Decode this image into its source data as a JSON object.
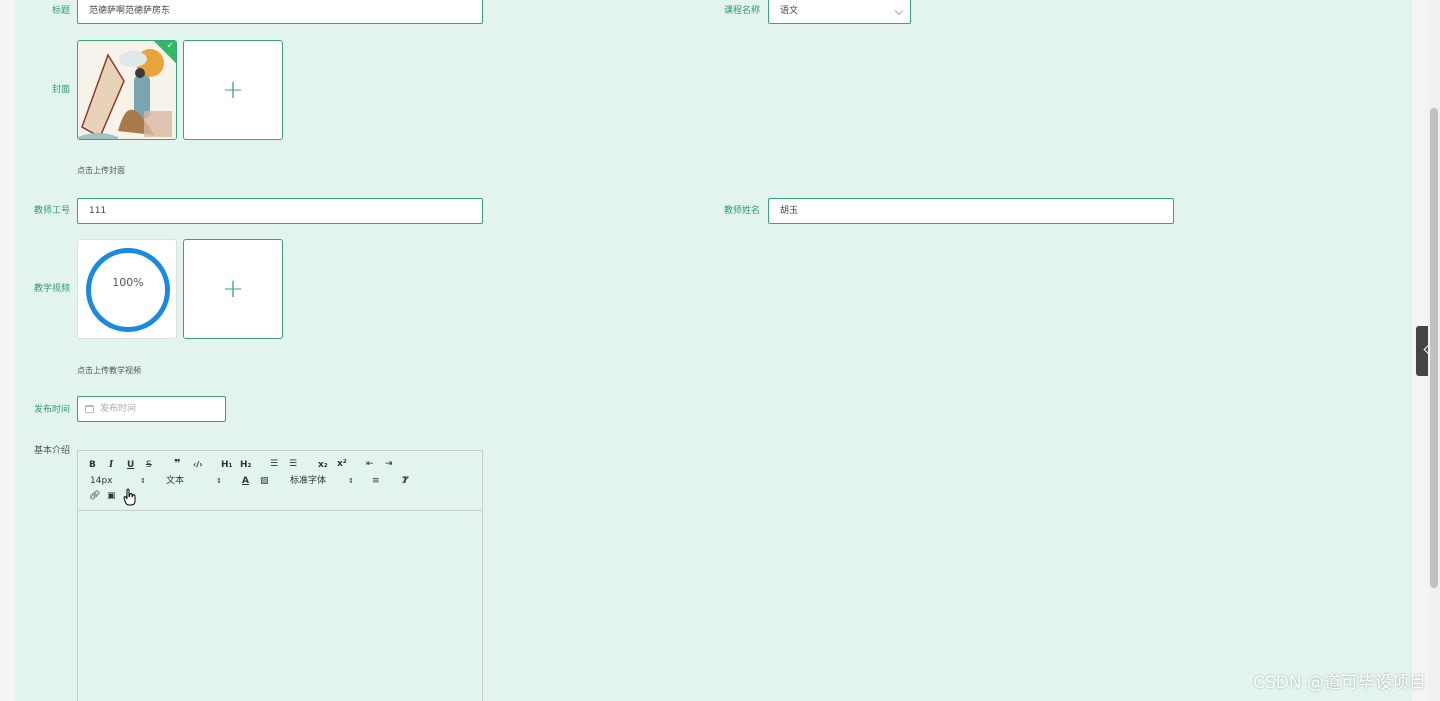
{
  "form": {
    "title": {
      "label": "标题",
      "value": "范德萨啊范德萨房东"
    },
    "course": {
      "label": "课程名称",
      "value": "语文"
    },
    "cover": {
      "label": "封面",
      "hint": "点击上传封面"
    },
    "teacher_id": {
      "label": "教师工号",
      "value": "111"
    },
    "teacher_name": {
      "label": "教师姓名",
      "value": "胡玉"
    },
    "video": {
      "label": "教学视频",
      "hint": "点击上传教学视频",
      "progress_text": "100%",
      "progress": 1.0
    },
    "publish_time": {
      "label": "发布时间",
      "placeholder": "发布时间"
    },
    "intro": {
      "label": "基本介绍"
    }
  },
  "editor": {
    "font_size": "14px",
    "header_type": "文本",
    "font_family": "标准字体"
  },
  "watermark": "CSDN @道可毕设项目",
  "colors": {
    "accent": "#3aa37c",
    "panel_bg": "#e3f4ee",
    "progress": "#1a8ae0",
    "badge": "#2fba63"
  },
  "icons": [
    "plus-icon",
    "check-icon",
    "calendar-icon",
    "chevron-left-icon",
    "chevron-down-icon",
    "bold-icon",
    "italic-icon",
    "underline-icon",
    "strike-icon",
    "quote-icon",
    "code-icon",
    "h1-icon",
    "h2-icon",
    "ordered-list-icon",
    "bullet-list-icon",
    "subscript-icon",
    "superscript-icon",
    "outdent-icon",
    "indent-icon",
    "font-color-icon",
    "background-color-icon",
    "align-icon",
    "clear-format-icon",
    "link-icon",
    "image-icon",
    "hand-cursor-icon"
  ]
}
